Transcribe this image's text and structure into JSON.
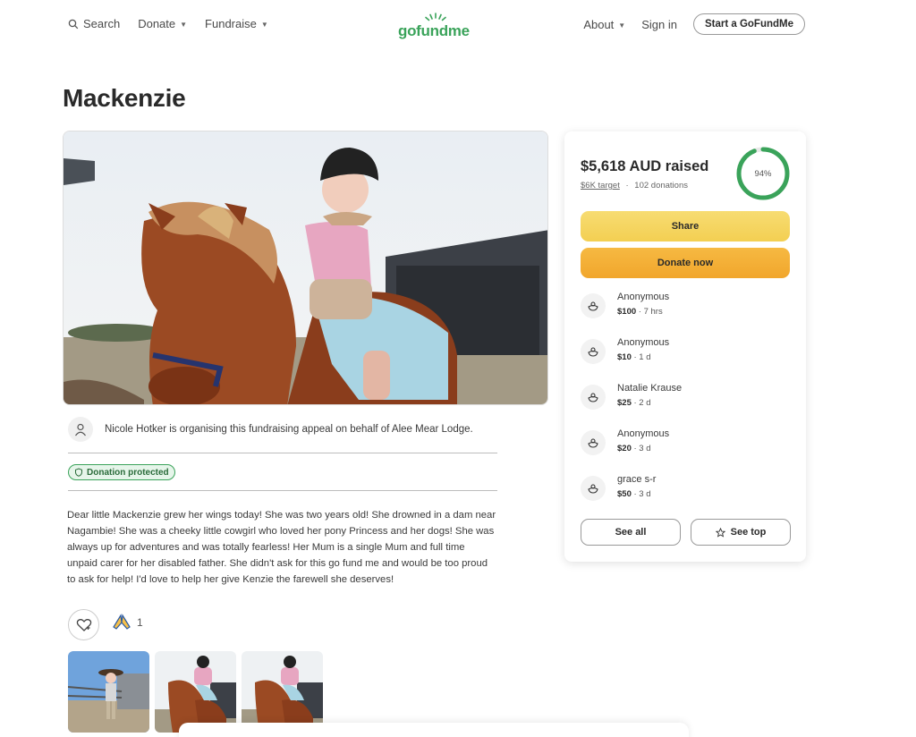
{
  "header": {
    "search_label": "Search",
    "donate_label": "Donate",
    "fundraise_label": "Fundraise",
    "logo_text": "gofundme",
    "about_label": "About",
    "signin_label": "Sign in",
    "start_label": "Start a GoFundMe"
  },
  "campaign": {
    "title": "Mackenzie",
    "organiser_text": "Nicole Hotker is organising this fundraising appeal on behalf of Alee Mear Lodge.",
    "protected_label": "Donation protected",
    "story": "Dear little Mackenzie grew her wings today! She was two years old! She drowned in a dam near Nagambie! She was a cheeky little cowgirl who loved her pony Princess and her dogs! She was always up for adventures and was totally fearless! Her Mum is a single Mum and full time unpaid carer for her disabled father. She didn't ask for this go fund me and would be too proud to ask for help! I'd love to help her give Kenzie the farewell she deserves!",
    "pray_count": "1"
  },
  "sidebar": {
    "raised": "$5,618 AUD raised",
    "target": "$6K target",
    "donations_count": "102 donations",
    "separator": "·",
    "progress_label": "94%",
    "progress_fraction": 0.94,
    "share_label": "Share",
    "donate_label": "Donate now",
    "donations": [
      {
        "name": "Anonymous",
        "amount": "$100",
        "time": "· 7 hrs"
      },
      {
        "name": "Anonymous",
        "amount": "$10",
        "time": "· 1 d"
      },
      {
        "name": "Natalie Krause",
        "amount": "$25",
        "time": "· 2 d"
      },
      {
        "name": "Anonymous",
        "amount": "$20",
        "time": "· 3 d"
      },
      {
        "name": "grace s-r",
        "amount": "$50",
        "time": "· 3 d"
      }
    ],
    "see_all_label": "See all",
    "see_top_label": "See top"
  },
  "colors": {
    "brand_green": "#3aa35a",
    "share_yellow": "#f3cf52",
    "donate_orange": "#f1a62c"
  }
}
